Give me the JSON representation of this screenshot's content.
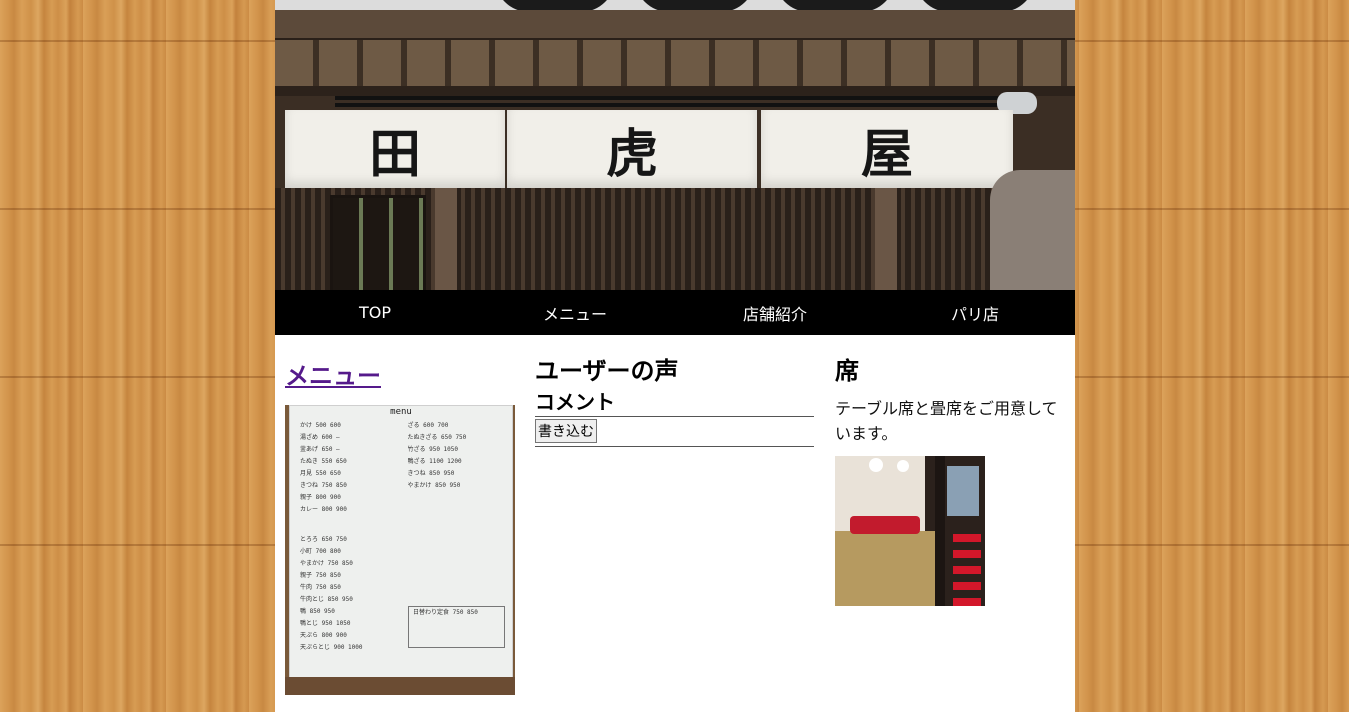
{
  "header": {
    "shop_sign_chars": [
      "田",
      "虎",
      "屋"
    ]
  },
  "nav": {
    "items": [
      "TOP",
      "メニュー",
      "店舗紹介",
      "パリ店"
    ]
  },
  "menu_section": {
    "title": "メニュー",
    "board": {
      "heading": "menu",
      "left_lines": [
        "かけ 500 600",
        "湯ざめ 600 —",
        "釜あげ 650 —",
        "たぬき 550 650",
        "月見 550 650",
        "きつね 750 850",
        "親子 800 900",
        "カレー 800 900"
      ],
      "right_lines": [
        "ざる 600 700",
        "たぬきざる 650 750",
        "竹ざる 950 1050",
        "鴨ざる 1100 1200",
        "きつね 850 950",
        "やまかけ 850 950"
      ],
      "lower_lines": [
        "とろろ 650 750",
        "小町 700 800",
        "やまかけ 750 850",
        "親子 750 850",
        "牛肉 750 850",
        "牛肉とじ 850 950",
        "鴨 850 950",
        "鴨とじ 950 1050",
        "天ぷら 800 900",
        "天ぷらとじ 900 1000"
      ],
      "box_text": "日替わり定食 750 850"
    }
  },
  "voice_section": {
    "title": "ユーザーの声",
    "subtitle": "コメント",
    "submit_label": "書き込む"
  },
  "seat_section": {
    "title": "席",
    "text": "テーブル席と畳席をご用意しています。"
  }
}
